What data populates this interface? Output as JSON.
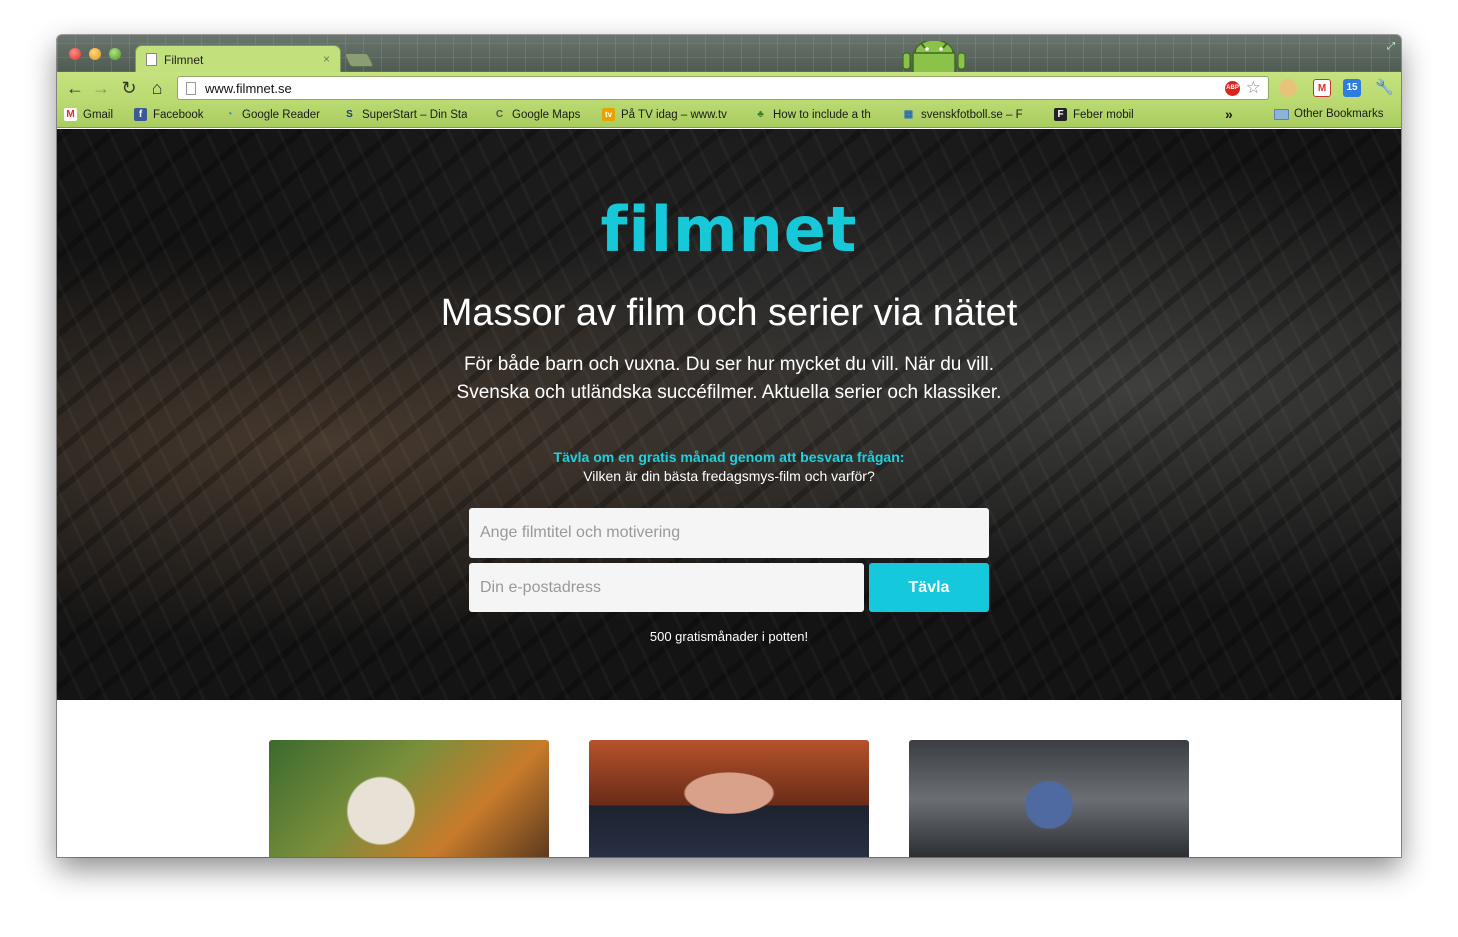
{
  "browser": {
    "tab_title": "Filmnet",
    "tab_close": "×",
    "url": "www.filmnet.se",
    "abp_label": "ABP",
    "calendar_badge": "15",
    "bookmarks": [
      {
        "label": "Gmail",
        "icon": "gmail-icon",
        "color": "#d93025",
        "glyph": "M"
      },
      {
        "label": "Facebook",
        "icon": "facebook-icon",
        "color": "#3b5998",
        "glyph": "f"
      },
      {
        "label": "Google Reader",
        "icon": "google-reader-icon",
        "color": "#2d7de0",
        "glyph": "◔"
      },
      {
        "label": "SuperStart – Din Sta",
        "icon": "superstart-icon",
        "color": "#1d3f7a",
        "glyph": "S"
      },
      {
        "label": "Google Maps",
        "icon": "google-maps-icon",
        "color": "#555555",
        "glyph": "C"
      },
      {
        "label": "På TV idag – www.tv",
        "icon": "tv-icon",
        "color": "#e8a300",
        "glyph": "tv"
      },
      {
        "label": "How to include a th",
        "icon": "tree-icon",
        "color": "#3a7d2a",
        "glyph": "♣"
      },
      {
        "label": "svenskfotboll.se – F",
        "icon": "svenskfotboll-icon",
        "color": "#2b6cb0",
        "glyph": "▦"
      },
      {
        "label": "Feber mobil",
        "icon": "feber-icon",
        "color": "#222222",
        "glyph": "F"
      }
    ],
    "bookmarks_overflow": "»",
    "other_bookmarks": "Other Bookmarks"
  },
  "page": {
    "logo": "filmnet",
    "headline": "Massor av film och serier via nätet",
    "subline1": "För både barn och vuxna. Du ser hur mycket du vill. När du vill.",
    "subline2": "Svenska och utländska succéfilmer. Aktuella serier och klassiker.",
    "contest_question_title": "Tävla om en gratis månad genom att besvara frågan:",
    "contest_question": "Vilken är din bästa fredagsmys-film och varför?",
    "title_input_placeholder": "Ange filmtitel och motivering",
    "email_input_placeholder": "Din e-postadress",
    "submit_label": "Tävla",
    "pot_text": "500 gratismånader i potten!"
  },
  "colors": {
    "accent": "#17c9d8",
    "browser_theme": "#b9d970"
  }
}
